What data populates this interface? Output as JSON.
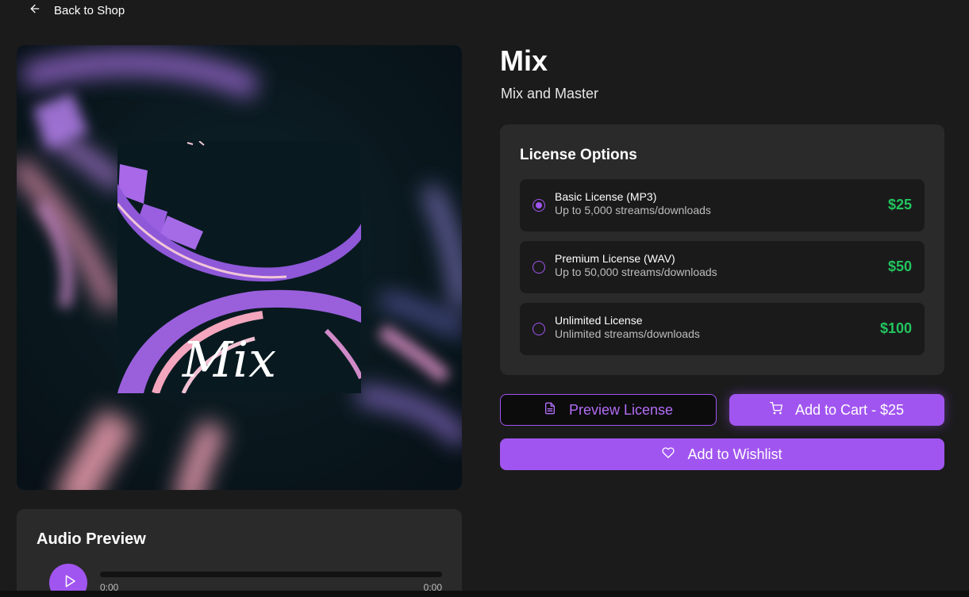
{
  "nav": {
    "back_label": "Back to Shop"
  },
  "product": {
    "title": "Mix",
    "subtitle": "Mix and Master",
    "cover_text": "Mix"
  },
  "licenses": {
    "heading": "License Options",
    "options": [
      {
        "name": "Basic License (MP3)",
        "desc": "Up to 5,000 streams/downloads",
        "price": "$25",
        "selected": true
      },
      {
        "name": "Premium License (WAV)",
        "desc": "Up to 50,000 streams/downloads",
        "price": "$50",
        "selected": false
      },
      {
        "name": "Unlimited License",
        "desc": "Unlimited streams/downloads",
        "price": "$100",
        "selected": false
      }
    ]
  },
  "actions": {
    "preview_label": "Preview License",
    "cart_label": "Add to Cart - $25",
    "wishlist_label": "Add to Wishlist"
  },
  "audio": {
    "heading": "Audio Preview",
    "current_time": "0:00",
    "duration": "0:00",
    "progress": 0
  },
  "colors": {
    "accent": "#a155f0",
    "price": "#22c55e",
    "background": "#1b1b1c",
    "card": "#2a2a2b"
  },
  "icons": {
    "back": "arrow-left-icon",
    "preview": "file-text-icon",
    "cart": "shopping-cart-icon",
    "wishlist": "heart-icon",
    "play": "play-icon"
  }
}
